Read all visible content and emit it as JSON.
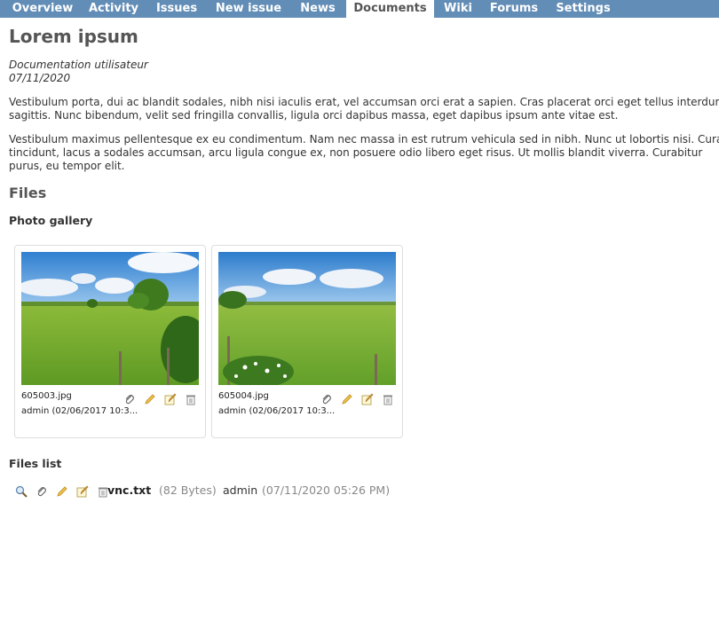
{
  "nav": {
    "tabs": [
      "Overview",
      "Activity",
      "Issues",
      "New issue",
      "News",
      "Documents",
      "Wiki",
      "Forums",
      "Settings"
    ],
    "active": "Documents"
  },
  "document": {
    "title": "Lorem ipsum",
    "category": "Documentation utilisateur",
    "date": "07/11/2020",
    "para1_line1": "Vestibulum porta, dui ac blandit sodales, nibh nisi iaculis erat, vel accumsan orci erat a sapien. Cras placerat orci eget tellus interdum",
    "para1_line2": "sagittis. Nunc bibendum, velit sed fringilla convallis, ligula orci dapibus massa, eget dapibus ipsum ante vitae est.",
    "para2_line1": "Vestibulum maximus pellentesque ex eu condimentum. Nam nec massa in est rutrum vehicula sed in nibh. Nunc ut lobortis nisi. Curabitur",
    "para2_line2": "tincidunt, lacus a sodales accumsan, arcu ligula congue ex, non posuere odio libero eget risus. Ut mollis blandit viverra. Curabitur",
    "para2_line3": "purus, eu tempor elit."
  },
  "files": {
    "heading": "Files",
    "gallery_heading": "Photo gallery",
    "gallery": [
      {
        "name": "605003.jpg",
        "author": "admin (02/06/2017 10:3..."
      },
      {
        "name": "605004.jpg",
        "author": "admin (02/06/2017 10:3..."
      }
    ],
    "list_heading": "Files list",
    "list": [
      {
        "name": "vnc.txt",
        "size": "(82 Bytes)",
        "author": "admin",
        "date": "(07/11/2020 05:26 PM)"
      }
    ]
  },
  "icons": [
    "paperclip-icon",
    "pencil-icon",
    "edit-note-icon",
    "trash-icon",
    "magnifier-icon"
  ],
  "colors": {
    "nav_bg": "#628db6",
    "nav_text": "#ffffff",
    "title": "#555555",
    "muted": "#888888"
  }
}
